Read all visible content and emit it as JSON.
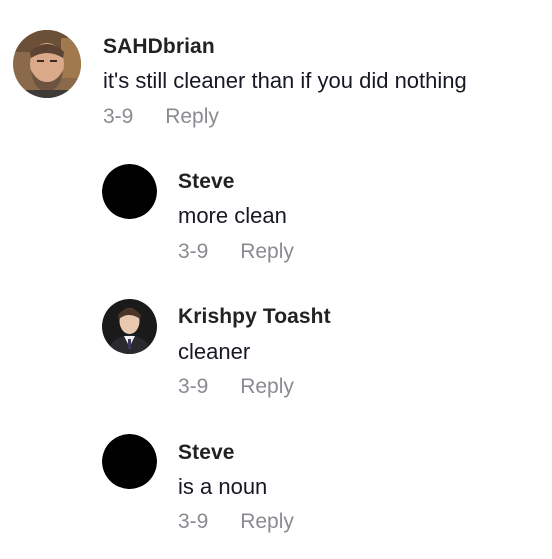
{
  "comments": [
    {
      "username": "SAHDbrian",
      "text": "it's still cleaner than if you did nothing",
      "date": "3-9",
      "reply_label": "Reply",
      "avatar": "bearded-man-photo"
    },
    {
      "username": "Steve",
      "text": "more clean",
      "date": "3-9",
      "reply_label": "Reply",
      "avatar": "black-circle"
    },
    {
      "username": "Krishpy Toasht",
      "text": "cleaner",
      "date": "3-9",
      "reply_label": "Reply",
      "avatar": "man-in-suit-photo"
    },
    {
      "username": "Steve",
      "text": "is a noun",
      "date": "3-9",
      "reply_label": "Reply",
      "avatar": "black-circle"
    }
  ]
}
